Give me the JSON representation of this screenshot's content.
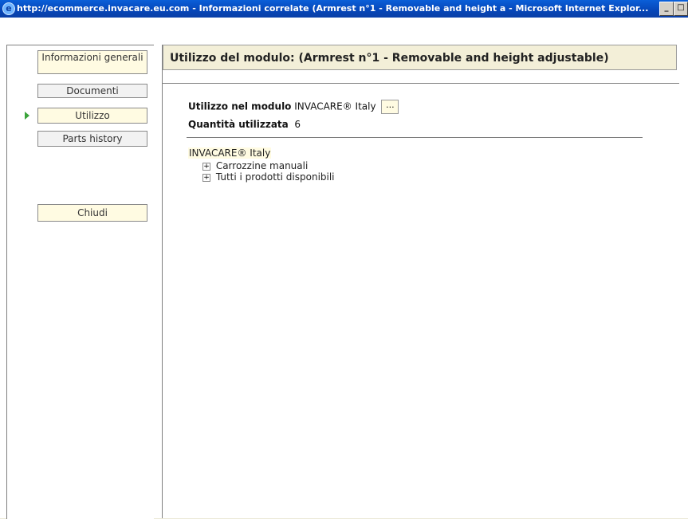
{
  "window": {
    "title": "http://ecommerce.invacare.eu.com - Informazioni correlate (Armrest n°1 - Removable and height a - Microsoft Internet Explor..."
  },
  "sidebar": {
    "items": [
      {
        "label": "Informazioni generali"
      },
      {
        "label": "Documenti"
      },
      {
        "label": "Utilizzo"
      },
      {
        "label": "Parts history"
      }
    ],
    "close_label": "Chiudi"
  },
  "main": {
    "header": "Utilizzo del modulo: (Armrest n°1 - Removable and height adjustable)",
    "module_label": "Utilizzo nel modulo",
    "module_value": "INVACARE® Italy",
    "browse_label": "...",
    "quantity_label": "Quantità utilizzata",
    "quantity_value": "6",
    "tree": {
      "root": "INVACARE® Italy",
      "children": [
        {
          "label": "Carrozzine manuali"
        },
        {
          "label": "Tutti i prodotti disponibili"
        }
      ]
    }
  }
}
